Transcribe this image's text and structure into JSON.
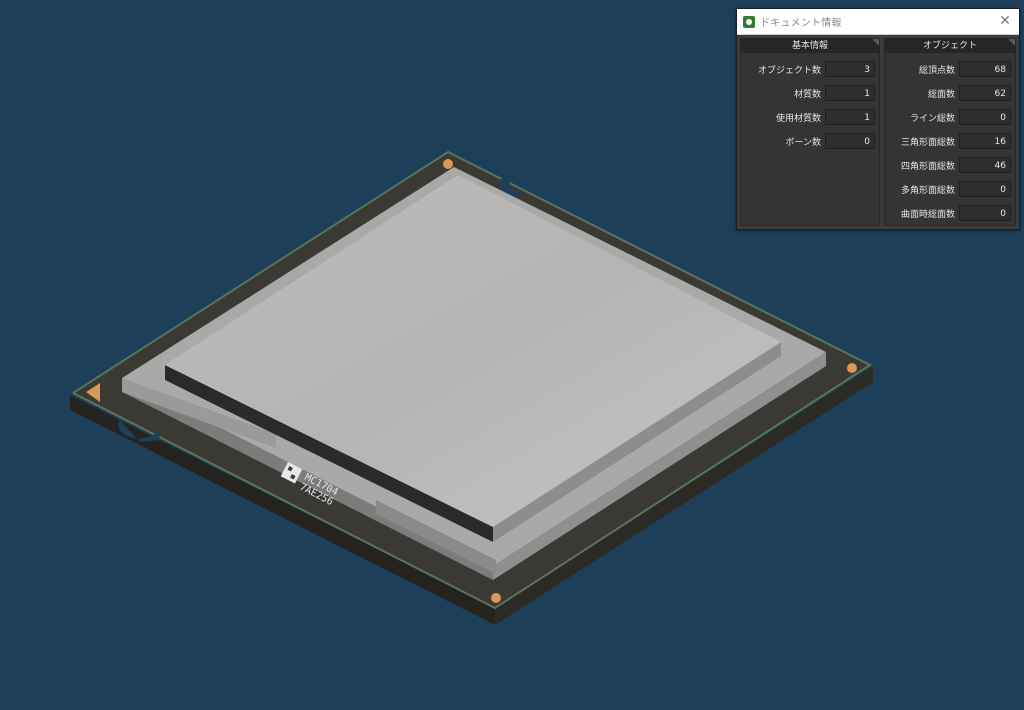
{
  "chip": {
    "marking_line1": "MC1704",
    "marking_line2": "7AE256"
  },
  "window": {
    "title": "ドキュメント情報",
    "close_glyph": "✕"
  },
  "basic_panel": {
    "header": "基本情報",
    "rows": [
      {
        "label": "オブジェクト数",
        "value": "3"
      },
      {
        "label": "材質数",
        "value": "1"
      },
      {
        "label": "使用材質数",
        "value": "1"
      },
      {
        "label": "ボーン数",
        "value": "0"
      }
    ]
  },
  "object_panel": {
    "header": "オブジェクト",
    "rows": [
      {
        "label": "総頂点数",
        "value": "68"
      },
      {
        "label": "総面数",
        "value": "62"
      },
      {
        "label": "ライン総数",
        "value": "0"
      },
      {
        "label": "三角形面総数",
        "value": "16"
      },
      {
        "label": "四角形面総数",
        "value": "46"
      },
      {
        "label": "多角形面総数",
        "value": "0"
      },
      {
        "label": "曲面時総面数",
        "value": "0"
      }
    ]
  },
  "colors": {
    "background": "#1d3f5a",
    "substrate": "#3a3832",
    "pcb_edge": "#4f6b52",
    "heat_spreader": "#b9b9b9",
    "corner_marker": "#d89a52"
  }
}
